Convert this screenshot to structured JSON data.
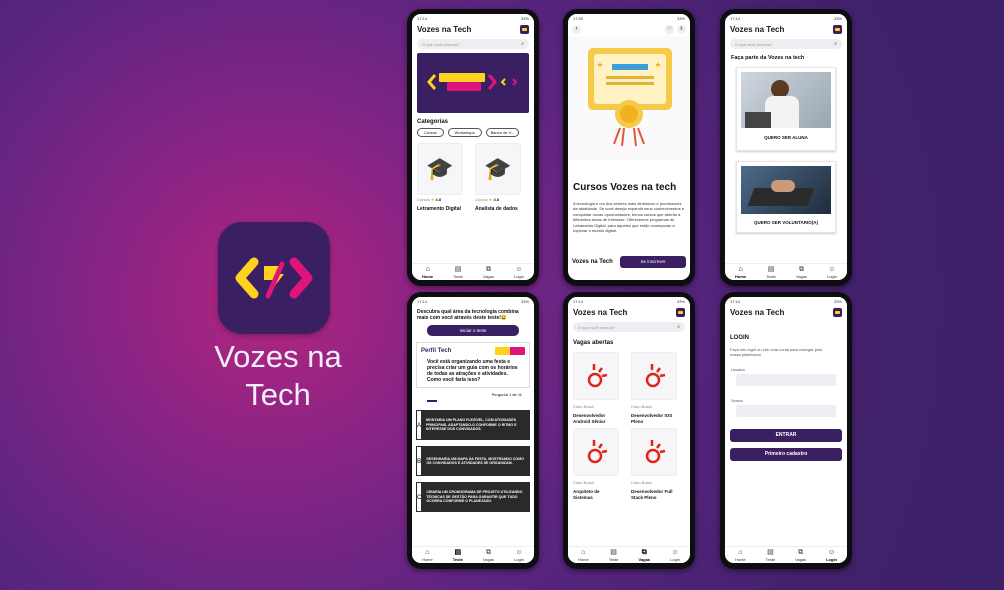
{
  "brand": {
    "app_name": "Vozes na Tech",
    "accent": "#3a1f63",
    "yellow": "#ffd21f",
    "pink": "#e0157a"
  },
  "nav": {
    "home": "Home",
    "teste": "Teste",
    "vagas": "Vagas",
    "login": "Login"
  },
  "status": {
    "time1": "17:14",
    "time2": "17:55",
    "time3": "17:14",
    "batt": "33%"
  },
  "screen1": {
    "title": "Vozes na Tech",
    "search": "O que você procura?",
    "categories_title": "Categorias",
    "chips": [
      "Cursos",
      "Workshops",
      "Banco de V..."
    ],
    "cards": [
      {
        "meta": "Cursos",
        "rating": "4.8",
        "name": "Letramento Digital"
      },
      {
        "meta": "Cursos",
        "rating": "4.8",
        "name": "Analista de dados"
      }
    ]
  },
  "screen2": {
    "title": "Cursos Vozes na tech",
    "body": "A tecnologia é um dos setores mais dinâmicos e promissores da atualidade. Se você deseja expandir seus conhecimentos e conquistar novas oportunidades, temos cursos que abrirão a diferentes áreas de interesse. Oferecemos programas de Letramento Digital, para aqueles que estão começando a explorar o mundo digital.",
    "footer_brand": "Vozes na Tech",
    "cta": "Se inscrever"
  },
  "screen3": {
    "title": "Vozes na Tech",
    "search": "O que você procura?",
    "heading": "Faça parte da Vozes na tech",
    "opt1": "QUERO SER ALUNA",
    "opt2": "QUERO SER VOLUNTARIO(A)"
  },
  "screen4": {
    "intro": "Descubra qual área da tecnologia combina mais com você através deste teste!😀",
    "start": "Iniciar o teste",
    "header": "Perfil Tech",
    "question": "Você está organizando uma festa e precisa criar um guia com os horários de todas as atrações e atividades. Como você faria isso?",
    "progress": "Pergunta 1 de 11",
    "answers": [
      {
        "letter": "A",
        "text": "MONTARIA UM PLANO FLEXÍVEL, COM ATIVIDADES PRINCIPAIS, ADAPTANDO-O CONFORME O RITMO E INTERESSE DOS CONVIDADOS."
      },
      {
        "letter": "B",
        "text": "DESENHARIA UM MAPA DA FESTA, MOSTRANDO COMO OS CONVIDADOS E ATIVIDADES SE ORGANIZAM."
      },
      {
        "letter": "C",
        "text": "CRIARIA UM CRONOGRAMA DE PROJETO UTILIZANDO TÉCNICAS DE GESTÃO PARA GARANTIR QUE TUDO OCORRA CONFORME O PLANEJADO."
      }
    ]
  },
  "screen5": {
    "title": "Vozes na Tech",
    "search": "O que você procura?",
    "heading": "Vagas abertas",
    "jobs": [
      {
        "company": "Claro Brasil",
        "role": "Desenvolvedor Android Sênior"
      },
      {
        "company": "Claro Brasil",
        "role": "Desenvolvedor IOS Pleno"
      },
      {
        "company": "Claro Brasil",
        "role": "Arquiteto de Sistemas"
      },
      {
        "company": "Claro Brasil",
        "role": "Desenvolvedor Full Stack Pleno"
      }
    ]
  },
  "screen6": {
    "title": "Vozes na Tech",
    "heading": "LOGIN",
    "desc": "Faça seu login ou crie uma conta para navegar pela nossa plataforma",
    "user_label": "Usuário",
    "pass_label": "Senha",
    "enter": "ENTRAR",
    "register": "Primeiro cadastro"
  }
}
